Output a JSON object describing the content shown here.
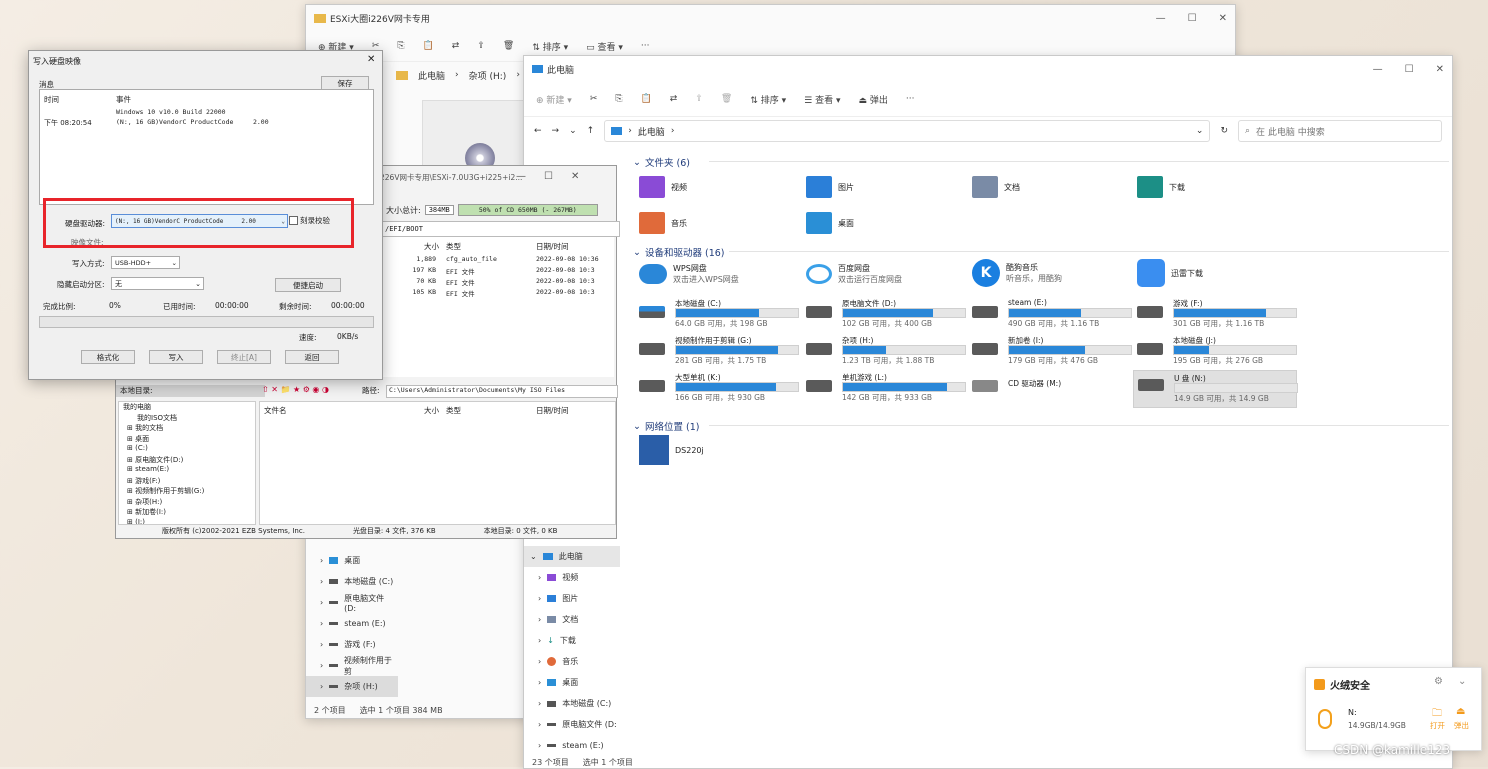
{
  "explorer_back": {
    "title": "ESXi大圈i226V网卡专用",
    "toolbar": [
      "新建",
      "排序",
      "查看",
      "···"
    ],
    "breadcrumb": [
      "此电脑",
      "杂项 (H:)",
      "N"
    ],
    "nav": [
      "桌面",
      "本地磁盘 (C:)",
      "原电脑文件 (D:",
      "steam (E:)",
      "游戏 (F:)",
      "视频制作用于剪",
      "杂项 (H:)"
    ],
    "status_count": "2 个项目",
    "status_sel": "选中 1 个项目  384 MB"
  },
  "explorer_front": {
    "title": "此电脑",
    "toolbar": {
      "new": "新建",
      "sort": "排序",
      "view": "查看",
      "eject": "弹出",
      "more": "···"
    },
    "breadcrumb": "此电脑",
    "search_placeholder": "在 此电脑 中搜索",
    "sections": {
      "folders": "文件夹 (6)",
      "devices": "设备和驱动器 (16)",
      "network": "网络位置 (1)"
    },
    "folders": [
      {
        "name": "视频",
        "color": "#8a4bd6"
      },
      {
        "name": "图片",
        "color": "#2b7fd8"
      },
      {
        "name": "文档",
        "color": "#7a8ba6"
      },
      {
        "name": "下载",
        "color": "#1c8f86"
      },
      {
        "name": "音乐",
        "color": "#e06a3a"
      },
      {
        "name": "桌面",
        "color": "#2a8fd6"
      }
    ],
    "clouds": [
      {
        "name": "WPS网盘",
        "sub": "双击进入WPS网盘"
      },
      {
        "name": "百度网盘",
        "sub": "双击运行百度网盘"
      },
      {
        "name": "酷狗音乐",
        "sub": "听音乐，用酷狗"
      },
      {
        "name": "迅雷下载",
        "sub": ""
      }
    ],
    "drives": [
      {
        "name": "本地磁盘 (C:)",
        "cap": "64.0 GB 可用，共 198 GB",
        "used": 0.68
      },
      {
        "name": "原电脑文件 (D:)",
        "cap": "102 GB 可用，共 400 GB",
        "used": 0.74
      },
      {
        "name": "steam (E:)",
        "cap": "490 GB 可用，共 1.16 TB",
        "used": 0.59
      },
      {
        "name": "游戏 (F:)",
        "cap": "301 GB 可用，共 1.16 TB",
        "used": 0.75
      },
      {
        "name": "视频制作用于剪辑 (G:)",
        "cap": "281 GB 可用，共 1.75 TB",
        "used": 0.84
      },
      {
        "name": "杂项 (H:)",
        "cap": "1.23 TB 可用，共 1.88 TB",
        "used": 0.35
      },
      {
        "name": "新加卷 (I:)",
        "cap": "179 GB 可用，共 476 GB",
        "used": 0.62
      },
      {
        "name": "本地磁盘 (J:)",
        "cap": "195 GB 可用，共 276 GB",
        "used": 0.29
      },
      {
        "name": "大型单机 (K:)",
        "cap": "166 GB 可用，共 930 GB",
        "used": 0.82
      },
      {
        "name": "单机游戏 (L:)",
        "cap": "142 GB 可用，共 933 GB",
        "used": 0.85
      },
      {
        "name": "CD 驱动器 (M:)",
        "cap": "",
        "used": null
      },
      {
        "name": "U 盘 (N:)",
        "cap": "14.9 GB 可用，共 14.9 GB",
        "used": 0.0
      }
    ],
    "network_items": [
      "DS220j"
    ],
    "nav": [
      "此电脑",
      "视频",
      "图片",
      "文档",
      "下载",
      "音乐",
      "桌面",
      "本地磁盘 (C:)",
      "原电脑文件 (D:",
      "steam (E:)"
    ],
    "status_count": "23 个项目",
    "status_sel": "选中 1 个项目"
  },
  "ultraiso": {
    "title_path": "226V网卡专用\\ESXi-7.0U3G+i225+i2...",
    "size_label": "大小总计:",
    "size_value": "384MB",
    "usage_text": "50% of CD 650MB (- 267MB)",
    "path": "/EFI/BOOT",
    "cols": [
      "大小",
      "类型",
      "日期/时间"
    ],
    "files": [
      {
        "size": "1,889",
        "type": "cfg_auto_file",
        "date": "2022-09-08 10:36"
      },
      {
        "size": "197 KB",
        "type": "EFI 文件",
        "date": "2022-09-08 10:3"
      },
      {
        "size": "70 KB",
        "type": "EFI 文件",
        "date": "2022-09-08 10:3"
      },
      {
        "size": "105 KB",
        "type": "EFI 文件",
        "date": "2022-09-08 10:3"
      }
    ],
    "local_title": "本地目录:",
    "local_path_label": "路径:",
    "local_path": "C:\\Users\\Administrator\\Documents\\My ISO Files",
    "local_cols": [
      "文件名",
      "大小",
      "类型",
      "日期/时间"
    ],
    "tree": [
      "我的电脑",
      "我的ISO文档",
      "我的文档",
      "桌面",
      "(C:)",
      "原电脑文件(D:)",
      "steam(E:)",
      "游戏(F:)",
      "视频制作用于剪辑(G:)",
      "杂项(H:)",
      "新加卷(I:)",
      "(J:)"
    ],
    "footer": [
      "版权所有 (c)2002-2021 EZB Systems, Inc.",
      "光盘目录: 4 文件, 376 KB",
      "本地目录: 0 文件, 0 KB"
    ]
  },
  "dialog": {
    "title": "写入硬盘映像",
    "msg_label": "消息",
    "save": "保存",
    "col_time": "时间",
    "col_event": "事件",
    "log": [
      {
        "time": "",
        "event": "Windows 10 v10.0 Build 22000"
      },
      {
        "time": "下午 08:20:54",
        "event": "(N:, 16 GB)VendorC ProductCode     2.00"
      }
    ],
    "drive_label": "硬盘驱动器:",
    "drive_value": "(N:, 16 GB)VendorC ProductCode     2.00",
    "verify_label": "刻录校验",
    "image_label": "映像文件:",
    "write_mode_label": "写入方式:",
    "write_mode_value": "USB-HDD+",
    "hide_label": "隐藏启动分区:",
    "hide_value": "无",
    "quick_boot": "便捷启动",
    "done_label": "完成比例:",
    "done_value": "0%",
    "elapsed_label": "已用时间:",
    "elapsed_value": "00:00:00",
    "remain_label": "剩余时间:",
    "remain_value": "00:00:00",
    "speed_label": "速度:",
    "speed_value": "0KB/s",
    "buttons": [
      "格式化",
      "写入",
      "终止[A]",
      "返回"
    ],
    "highlight_color": "#e8242a"
  },
  "toast": {
    "title": "火绒安全",
    "drive": "N:",
    "cap": "14.9GB/14.9GB",
    "open": "打开",
    "eject": "弹出"
  },
  "watermark": "CSDN @kamille123"
}
